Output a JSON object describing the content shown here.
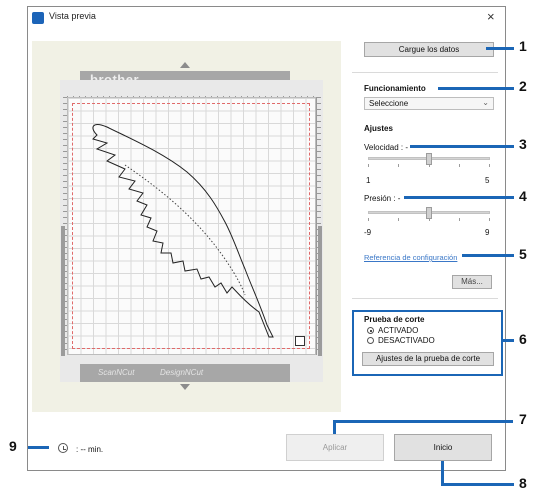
{
  "window": {
    "title": "Vista previa",
    "close_glyph": "×"
  },
  "preview": {
    "brand_top": "brother",
    "brand_bottom_left": "ScanNCut",
    "brand_bottom_right": "DesignNCut"
  },
  "panel": {
    "load_data_label": "Cargue los datos",
    "funcionamiento_label": "Funcionamiento",
    "select_value": "Seleccione",
    "ajustes_label": "Ajustes",
    "velocidad": {
      "label": "Velocidad : -",
      "min": "1",
      "max": "5",
      "level": 0.5
    },
    "presion": {
      "label": "Presión : -",
      "min": "-9",
      "max": "9",
      "level": 0.5
    },
    "reference_link": "Referencia de configuración",
    "more_label": "Más..."
  },
  "cut_test": {
    "title": "Prueba de corte",
    "options": [
      "ACTIVADO",
      "DESACTIVADO"
    ],
    "selected": "ACTIVADO",
    "settings_button": "Ajustes de la prueba de corte"
  },
  "footer": {
    "time_text": ":  -- min.",
    "apply_label": "Aplicar",
    "start_label": "Inicio"
  },
  "callouts": [
    "1",
    "2",
    "3",
    "4",
    "5",
    "6",
    "7",
    "8",
    "9"
  ],
  "colors": {
    "accent": "#1b66b6",
    "link": "#3a77c7",
    "cut_line": "#e06a6a"
  },
  "icons": [
    "app-icon",
    "close-icon",
    "clock-icon",
    "chevron-down-icon",
    "arrow-up-icon",
    "arrow-down-icon"
  ]
}
